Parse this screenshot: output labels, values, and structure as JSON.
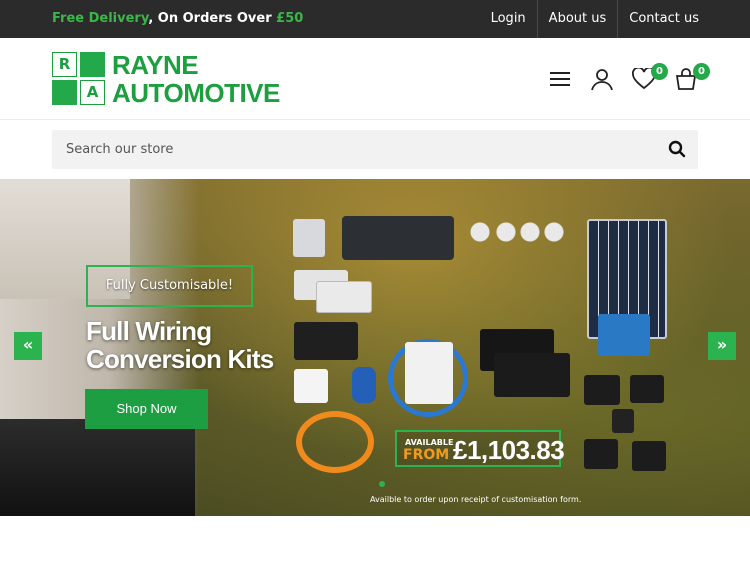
{
  "topbar": {
    "promo_prefix": "Free Delivery",
    "promo_middle": ", On Orders Over ",
    "promo_amount": "£50",
    "links": [
      "Login",
      "About us",
      "Contact us"
    ]
  },
  "header": {
    "logo_letters": [
      "R",
      "",
      "",
      "A"
    ],
    "logo_line1": "RAYNE",
    "logo_line2": "AUTOMOTIVE",
    "wishlist_count": "0",
    "cart_count": "0",
    "icons": [
      "menu-icon",
      "user-icon",
      "heart-icon",
      "cart-icon"
    ]
  },
  "search": {
    "placeholder": "Search our store",
    "value": ""
  },
  "banner": {
    "tag": "Fully Customisable!",
    "headline_line1": "Full Wiring",
    "headline_line2": "Conversion Kits",
    "button_label": "Shop Now",
    "available_label": "AVAILABLE",
    "from_label": "FROM",
    "price": "£1,103.83",
    "footnote": "Availble to order upon receipt of customisation form.",
    "prev_icon": "«",
    "next_icon": "»"
  },
  "colors": {
    "brand_green": "#1d9e3f",
    "accent_green": "#2bb34f",
    "topbar_bg": "#2b2b2b",
    "price_orange": "#f29a1c"
  }
}
